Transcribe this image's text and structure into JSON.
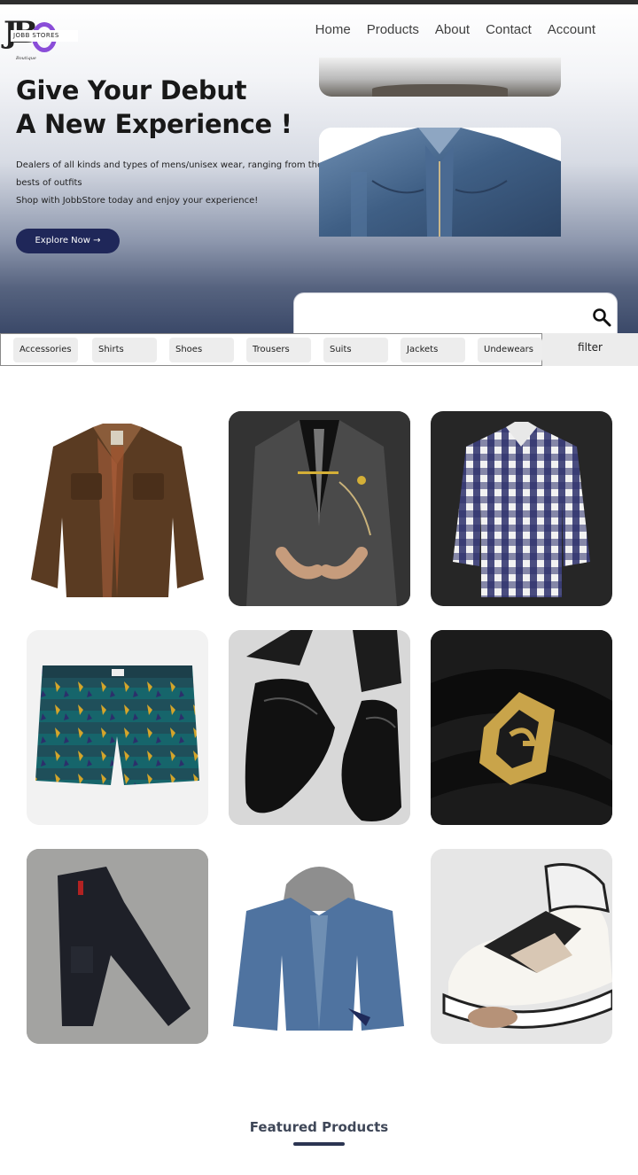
{
  "header": {
    "logo": {
      "letters": "JB",
      "band_text": "JOBB STORES",
      "subtitle": "Boutique"
    },
    "nav": [
      "Home",
      "Products",
      "About",
      "Contact",
      "Account"
    ]
  },
  "hero": {
    "title_line1": "Give Your Debut",
    "title_line2": "A New Experience !",
    "description": "Dealers of all kinds and types of mens/unisex wear, ranging from the bests of outfits",
    "tagline": "Shop with JobbStore today and enjoy your experience!",
    "cta_label": "Explore Now →",
    "images": [
      "clothing-photo",
      "denim-jacket-photo"
    ]
  },
  "search": {
    "placeholder": "",
    "value": "",
    "icon": "search-icon"
  },
  "categories": [
    "Accessories",
    "Shirts",
    "Shoes",
    "Trousers",
    "Suits",
    "Jackets",
    "Undewears"
  ],
  "filter_label": "filter",
  "products": [
    {
      "name": "brown-flannel-lined-jacket",
      "bg": "#ffffff"
    },
    {
      "name": "grey-three-piece-suit",
      "bg": "#3a3a3a"
    },
    {
      "name": "navy-checked-shirt",
      "bg": "#262626"
    },
    {
      "name": "green-patterned-boxer-shorts",
      "bg": "#f2f2f2"
    },
    {
      "name": "black-leather-loafers",
      "bg": "#dcdcdc"
    },
    {
      "name": "black-belt-gold-buckle",
      "bg": "#1e1e1e"
    },
    {
      "name": "black-cargo-jeans",
      "bg": "#9a9a98"
    },
    {
      "name": "hooded-denim-jacket",
      "bg": "#ffffff"
    },
    {
      "name": "chunky-sneakers",
      "bg": "#ececec"
    }
  ],
  "featured": {
    "title": "Featured Products"
  },
  "colors": {
    "accent": "#1f2759",
    "hero_bottom": "#3a4868"
  }
}
